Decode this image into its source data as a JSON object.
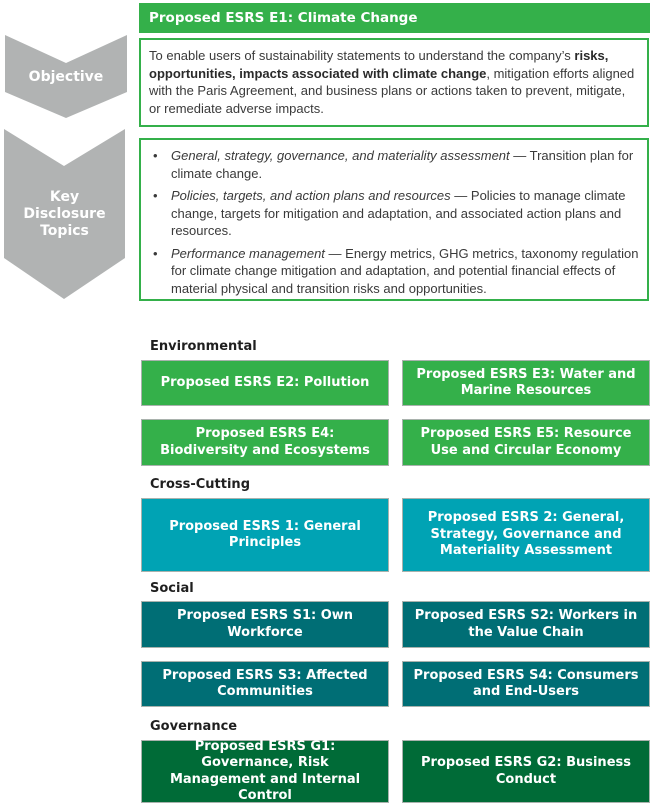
{
  "colors": {
    "environmental": "#34b04a",
    "cross_cutting": "#00a3b4",
    "social": "#006e75",
    "governance": "#006b37",
    "chevron": "#b1b3b3",
    "header": "#34b04a"
  },
  "side_labels": {
    "objective": "Objective",
    "key_topics": [
      "Key",
      "Disclosure",
      "Topics"
    ]
  },
  "e1": {
    "title": "Proposed ESRS E1: Climate Change",
    "objective": {
      "before": "To enable users of sustainability statements to understand the company’s ",
      "bold": "risks, opportunities, impacts associated with climate change",
      "after": ", mitigation efforts aligned with the Paris Agreement, and business plans or actions taken to prevent, mitigate, or remediate adverse impacts."
    },
    "topics": [
      {
        "bullet": "•",
        "italic": "General, strategy, governance, and materiality assessment",
        "text": " — Transition plan for climate change."
      },
      {
        "bullet": "•",
        "italic": "Policies, targets, and action plans and resources",
        "text": " — Policies to manage climate change, targets for mitigation and adaptation, and associated action plans and resources."
      },
      {
        "bullet": "•",
        "italic": "Performance management",
        "text": " — Energy metrics, GHG metrics, taxonomy regulation for climate change mitigation and adaptation, and potential financial effects of material physical and transition risks and opportunities."
      }
    ]
  },
  "categories": [
    {
      "label": "Environmental",
      "tiles": [
        "Proposed ESRS E2: Pollution",
        "Proposed ESRS E3: Water and Marine Resources",
        "Proposed ESRS E4: Biodiversity and Ecosystems",
        "Proposed ESRS E5: Resource Use and Circular Economy"
      ]
    },
    {
      "label": "Cross-Cutting",
      "tiles": [
        "Proposed ESRS 1: General Principles",
        "Proposed ESRS 2: General, Strategy, Governance and Materiality Assessment"
      ]
    },
    {
      "label": "Social",
      "tiles": [
        "Proposed ESRS S1: Own Workforce",
        "Proposed ESRS S2: Workers in the Value Chain",
        "Proposed ESRS S3: Affected Communities",
        "Proposed ESRS S4: Consumers and End-Users"
      ]
    },
    {
      "label": "Governance",
      "tiles": [
        "Proposed ESRS G1: Governance, Risk Management and Internal Control",
        "Proposed ESRS G2: Business Conduct"
      ]
    }
  ]
}
